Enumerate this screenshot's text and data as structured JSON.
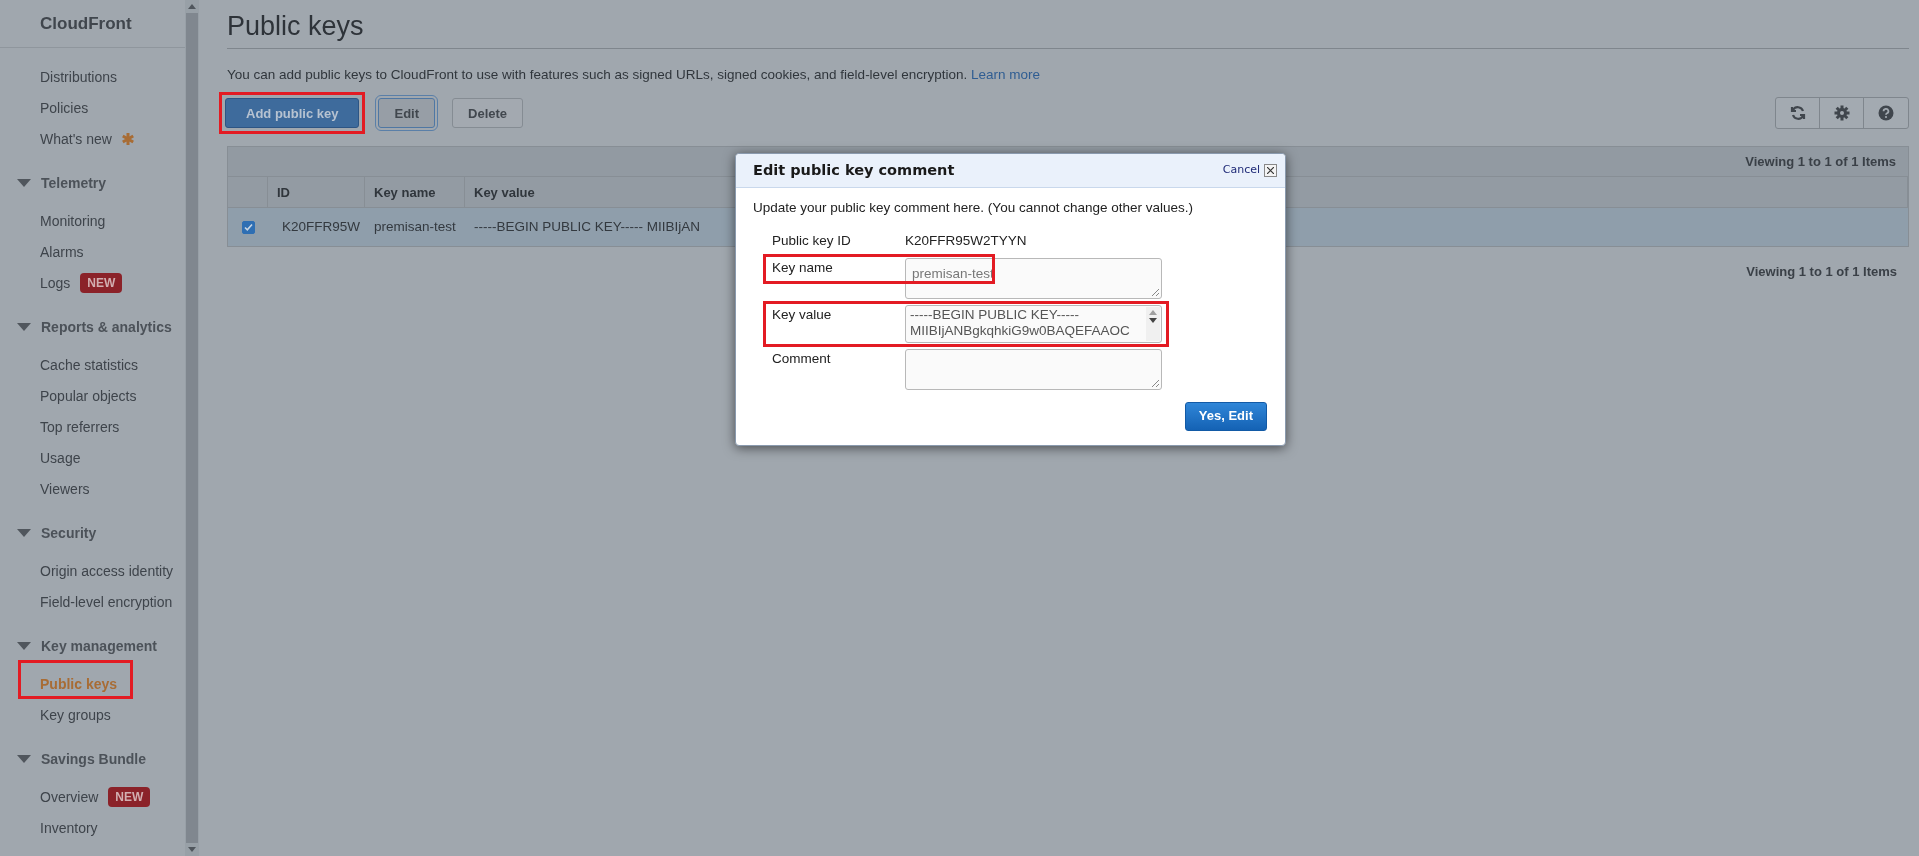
{
  "sidebar": {
    "title": "CloudFront",
    "sections": [
      {
        "items": [
          {
            "label": "Distributions",
            "selected": false
          },
          {
            "label": "Policies",
            "selected": false
          },
          {
            "label": "What's new",
            "selected": false,
            "starred": true
          }
        ]
      },
      {
        "heading": "Telemetry",
        "expanded": true,
        "items": [
          {
            "label": "Monitoring",
            "selected": false
          },
          {
            "label": "Alarms",
            "selected": false
          },
          {
            "label": "Logs",
            "selected": false,
            "badge": "NEW"
          }
        ]
      },
      {
        "heading": "Reports & analytics",
        "expanded": true,
        "items": [
          {
            "label": "Cache statistics",
            "selected": false
          },
          {
            "label": "Popular objects",
            "selected": false
          },
          {
            "label": "Top referrers",
            "selected": false
          },
          {
            "label": "Usage",
            "selected": false
          },
          {
            "label": "Viewers",
            "selected": false
          }
        ]
      },
      {
        "heading": "Security",
        "expanded": true,
        "items": [
          {
            "label": "Origin access identity",
            "selected": false
          },
          {
            "label": "Field-level encryption",
            "selected": false
          }
        ]
      },
      {
        "heading": "Key management",
        "expanded": true,
        "items": [
          {
            "label": "Public keys",
            "selected": true,
            "highlighted": true
          },
          {
            "label": "Key groups",
            "selected": false
          }
        ]
      },
      {
        "heading": "Savings Bundle",
        "expanded": true,
        "items": [
          {
            "label": "Overview",
            "selected": false,
            "badge": "NEW"
          },
          {
            "label": "Inventory",
            "selected": false
          }
        ]
      }
    ]
  },
  "main": {
    "title": "Public keys",
    "description": "You can add public keys to CloudFront to use with features such as signed URLs, signed cookies, and field-level encryption.",
    "link": "Learn more",
    "buttons": [
      {
        "label": "Add public key",
        "kind": "primary",
        "highlighted": true,
        "focused": false
      },
      {
        "label": "Edit",
        "kind": "default",
        "highlighted": false,
        "focused": true
      },
      {
        "label": "Delete",
        "kind": "default",
        "highlighted": false,
        "focused": false
      }
    ],
    "table": {
      "pager_top": "Viewing 1 to 1 of 1 Items",
      "columns": [
        "ID",
        "Key name",
        "Key value"
      ],
      "rows": [
        {
          "selected": true,
          "cells": [
            "K20FFR95W",
            "premisan-test",
            "-----BEGIN PUBLIC KEY----- MIIBIjAN"
          ]
        }
      ],
      "pager_bottom": "Viewing 1 to 1 of 1 Items"
    }
  },
  "dialog": {
    "title": "Edit public key comment",
    "cancel": "Cancel",
    "intro": "Update your public key comment here. (You cannot change other values.)",
    "fields": [
      {
        "label": "Public key ID",
        "kind": "static",
        "value": "K20FFR95W2TYYN"
      },
      {
        "label": "Key name",
        "kind": "textarea",
        "value": "premisan-test",
        "highlighted": true
      },
      {
        "label": "Key value",
        "kind": "scrolltext",
        "lines": [
          "-----BEGIN PUBLIC KEY-----",
          "MIIBIjANBgkqhkiG9w0BAQEFAAOC"
        ],
        "highlighted": true
      },
      {
        "label": "Comment",
        "kind": "textarea"
      }
    ],
    "confirm": "Yes, Edit"
  }
}
